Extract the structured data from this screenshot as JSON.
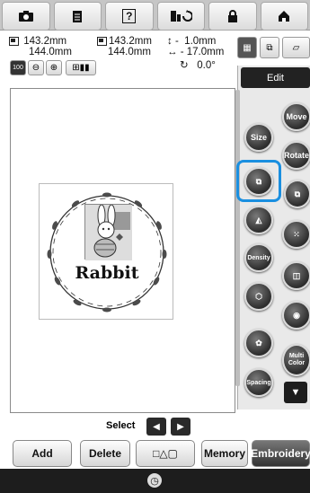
{
  "toolbar": {
    "items": [
      {
        "icon": "camera-icon"
      },
      {
        "icon": "document-icon"
      },
      {
        "icon": "help-icon",
        "label": "?"
      },
      {
        "icon": "sewing-foot-icon"
      },
      {
        "icon": "lock-icon"
      },
      {
        "icon": "home-icon"
      }
    ]
  },
  "info": {
    "width1": "143.2mm",
    "height1": "144.0mm",
    "width2": "143.2mm",
    "height2": "144.0mm",
    "vertical_offset": "1.0mm",
    "horizontal_offset": "17.0mm",
    "rotation": "0.0°",
    "zoom_label": "100"
  },
  "panel": {
    "tab_label": "Edit",
    "buttons": {
      "move": "Move",
      "size": "Size",
      "rotate": "Rotate",
      "density": "Density",
      "multi_color": "Multi Color",
      "spacing": "Spacing"
    }
  },
  "design": {
    "text": "Rabbit"
  },
  "select": {
    "label": "Select"
  },
  "bottom": {
    "add": "Add",
    "delete": "Delete",
    "memory": "Memory",
    "embroidery": "Embroidery"
  },
  "colors": {
    "highlight": "#1a8fe0",
    "toolbar_bg": "#c6c6c6",
    "statusbar_bg": "#1d1d1d"
  }
}
